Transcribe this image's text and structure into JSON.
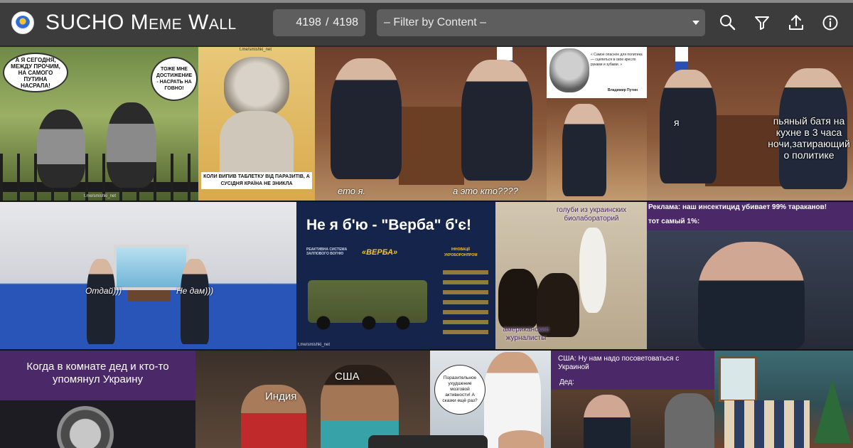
{
  "header": {
    "title": "SUCHO Meme Wall",
    "count_shown": "4198",
    "count_separator": "/",
    "count_total": "4198",
    "filter_placeholder": "– Filter by Content –",
    "tools": [
      "search-icon",
      "filter-icon",
      "upload-icon",
      "info-icon"
    ]
  },
  "colors": {
    "topbar": "#3c3c3c",
    "input_bg": "#5e5e5e",
    "purple_banner": "#4b2868",
    "navy_poster": "#15244a",
    "accent_yellow": "#f1c232"
  },
  "memes": [
    {
      "bubble_left": "А Я СЕГОДНЯ, МЕЖДУ ПРОЧИМ, НА САМОГО ПУТИНА НАСРАЛА!",
      "bubble_right": "ТОЖЕ МНЕ ДОСТИЖЕНИЕ - НАСРАТЬ НА ГОВНО!",
      "watermark": "t.me/smishki_net"
    },
    {
      "caption": "КОЛИ ВИПИВ ТАБЛЕТКУ ВІД ПАРАЗИТІВ, А СУСІДНЯ КРАЇНА НЕ ЗНИКЛА",
      "watermark": "t.me/smishki_net"
    },
    {
      "caption_left": "ето я.",
      "caption_right": "а это кто????"
    },
    {
      "quote": "« Самое опасное для политика — сцепиться в свое кресло руками и зубами. »",
      "author": "Владимир Путин"
    },
    {
      "left_label": "я",
      "caption": "пьяный батя на кухне в 3 часа ночи,затирающий о политике"
    },
    {
      "caption_left": "Отдай)))",
      "caption_right": "Не дам)))"
    },
    {
      "headline": "Не я б'ю - \"Верба\" б'є!",
      "subtitle": "РЕАКТИВНА СИСТЕМА ЗАЛПОВОГО ВОГНЮ",
      "system_name": "«ВЕРБА»",
      "brand": "УКРОБОРОНПРОМ",
      "brand_tag": "ІННОВАЦІЇ",
      "watermark": "t.me/smishki_net"
    },
    {
      "caption_top": "голуби из украинских биолабораторий",
      "caption_bottom": "американские журналисты"
    },
    {
      "line1": "Реклама: наш инсектицид убивает 99% тараканов!",
      "line2": "тот самый 1%:"
    },
    {
      "caption": "Когда в комнате дед и кто-то упомянул Украину"
    },
    {
      "label_left": "Индия",
      "label_right": "США"
    },
    {
      "bubble": "Поразительное ухудшение мозговой активности! А сказки ещё раз?"
    },
    {
      "line1": "США: Ну нам надо посоветоваться с Украиной",
      "line2": "Дед:"
    },
    {}
  ]
}
